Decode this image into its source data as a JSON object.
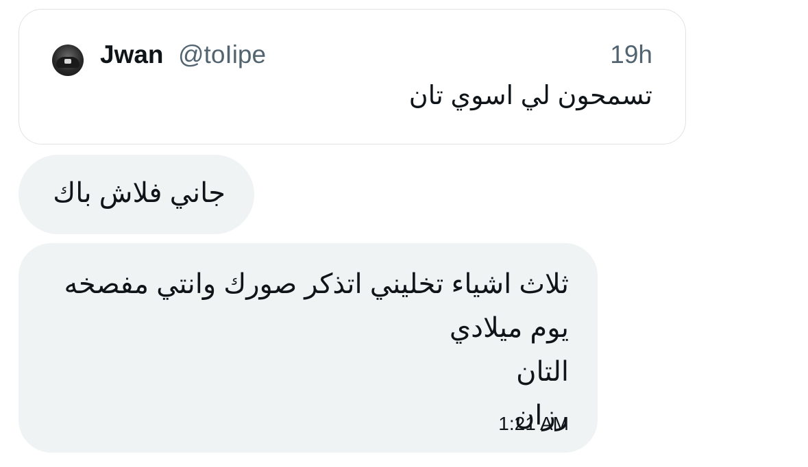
{
  "quote": {
    "name": "Jwan",
    "handle": "@toIipe",
    "time": "19h",
    "text": "تسمحون لي اسوي تان"
  },
  "messages": [
    {
      "text": "جاني فلاش باك"
    },
    {
      "lines": [
        "ثلاث اشياء تخليني اتذكر صورك وانتي مفصخه",
        "يوم ميلادي",
        "التان",
        "رزان"
      ],
      "time": "1:21 AM"
    }
  ]
}
